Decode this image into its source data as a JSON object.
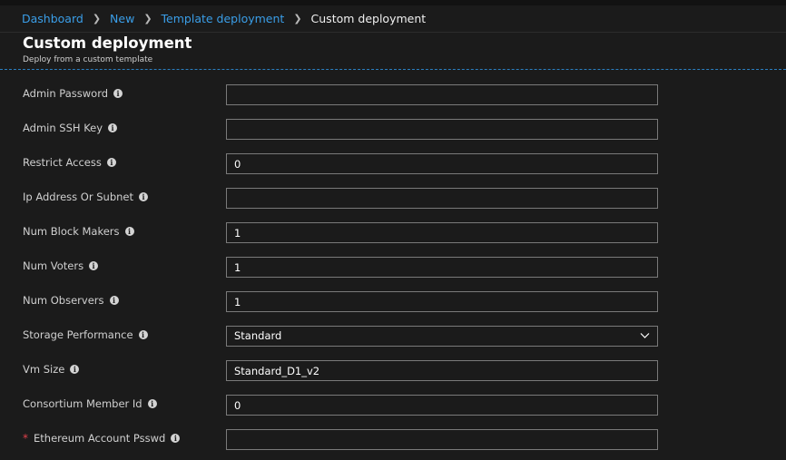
{
  "breadcrumb": {
    "items": [
      "Dashboard",
      "New",
      "Template deployment"
    ],
    "current": "Custom deployment"
  },
  "header": {
    "title": "Custom deployment",
    "subtitle": "Deploy from a custom template"
  },
  "form": {
    "fields": [
      {
        "label": "Admin Password",
        "value": "",
        "required": false
      },
      {
        "label": "Admin SSH Key",
        "value": "",
        "required": false
      },
      {
        "label": "Restrict Access",
        "value": "0",
        "required": false
      },
      {
        "label": "Ip Address Or Subnet",
        "value": "",
        "required": false
      },
      {
        "label": "Num Block Makers",
        "value": "1",
        "required": false
      },
      {
        "label": "Num Voters",
        "value": "1",
        "required": false
      },
      {
        "label": "Num Observers",
        "value": "1",
        "required": false
      },
      {
        "label": "Storage Performance",
        "value": "Standard",
        "type": "select"
      },
      {
        "label": "Vm Size",
        "value": "Standard_D1_v2",
        "required": false
      },
      {
        "label": "Consortium Member Id",
        "value": "0",
        "required": false
      },
      {
        "label": "Ethereum Account Psswd",
        "value": "",
        "required": true
      }
    ]
  },
  "icons": {
    "info": "info-icon",
    "chevron": "chevron-down-icon",
    "separator": "chevron-right-icon"
  },
  "colors": {
    "background": "#1b1b1b",
    "link": "#3a9ee8",
    "accent_line": "#2b7fc1",
    "required": "#e0404a",
    "input_border": "#7a7a7a"
  }
}
